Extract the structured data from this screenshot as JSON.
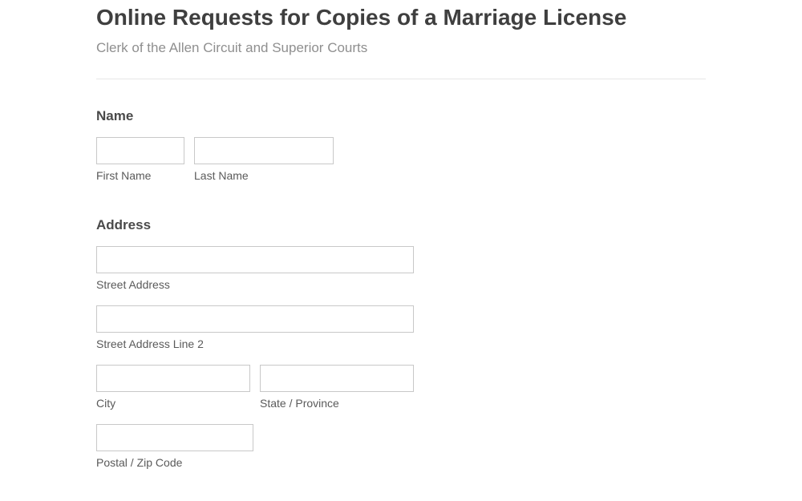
{
  "header": {
    "title": "Online Requests for Copies of a Marriage License",
    "subtitle": "Clerk of the Allen Circuit and Superior Courts"
  },
  "sections": {
    "name": {
      "heading": "Name",
      "first_name_label": "First Name",
      "last_name_label": "Last Name"
    },
    "address": {
      "heading": "Address",
      "street_label": "Street Address",
      "street2_label": "Street Address Line 2",
      "city_label": "City",
      "state_label": "State / Province",
      "postal_label": "Postal / Zip Code"
    }
  }
}
